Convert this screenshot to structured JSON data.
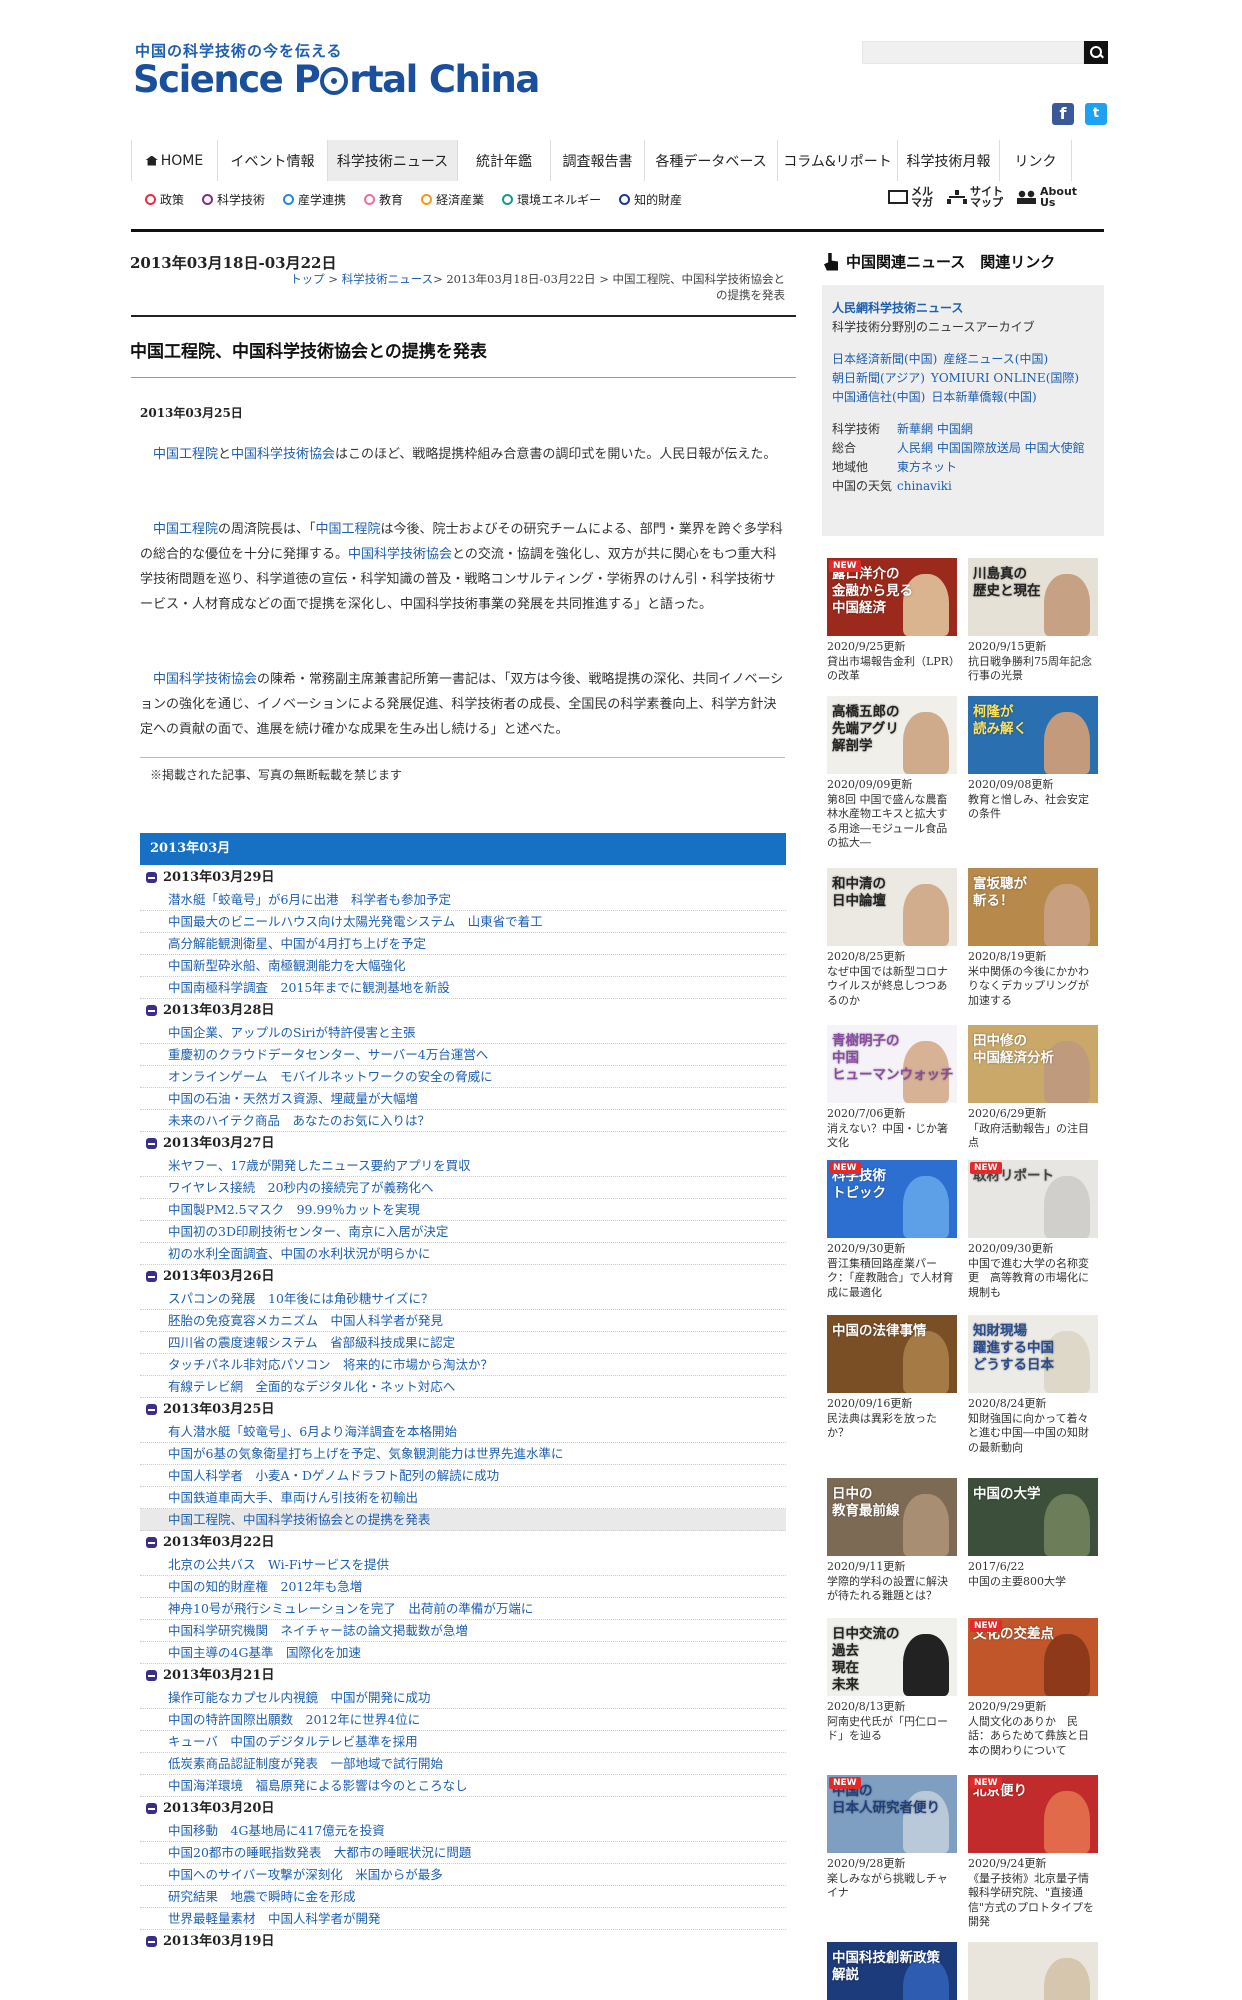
{
  "header": {
    "tagline": "中国の科学技術の今を伝える",
    "logo_part1": "Science P",
    "logo_part2": "rtal",
    "logo_part3": "China"
  },
  "global_nav": [
    {
      "label": "HOME",
      "width": 87
    },
    {
      "label": "イベント情報",
      "width": 110
    },
    {
      "label": "科学技術ニュース",
      "width": 130,
      "active": true
    },
    {
      "label": "統計年鑑",
      "width": 93
    },
    {
      "label": "調査報告書",
      "width": 94
    },
    {
      "label": "各種データベース",
      "width": 133
    },
    {
      "label": "コラム&リポート",
      "width": 120
    },
    {
      "label": "科学技術月報",
      "width": 102
    },
    {
      "label": "リンク",
      "width": 72
    }
  ],
  "sub_nav": [
    {
      "label": "政策",
      "color": "#e0304a"
    },
    {
      "label": "科学技術",
      "color": "#7c2f8d"
    },
    {
      "label": "産学連携",
      "color": "#2e86d1"
    },
    {
      "label": "教育",
      "color": "#ef6da0"
    },
    {
      "label": "経済産業",
      "color": "#f39a1e"
    },
    {
      "label": "環境エネルギー",
      "color": "#139d8a"
    },
    {
      "label": "知的財産",
      "color": "#1b3a8f"
    }
  ],
  "util_nav": [
    {
      "line1": "メル",
      "line2": "マガ"
    },
    {
      "line1": "サイト",
      "line2": "マップ"
    },
    {
      "line1": "About",
      "line2": "Us"
    }
  ],
  "main": {
    "date_range": "2013年03月18日-03月22日",
    "breadcrumb_top": "トップ",
    "breadcrumb_news": "科学技術ニュース",
    "breadcrumb_rest": "> 2013年03月18日-03月22日 > 中国工程院、中国科学技術協会との提携を発表",
    "title": "中国工程院、中国科学技術協会との提携を発表",
    "article_date": "2013年03月25日",
    "para1": {
      "l1": "中国工程院",
      "t1": "と",
      "l2": "中国科学技術協会",
      "t2": "はこのほど、戦略提携枠組み合意書の調印式を開いた。人民日報が伝えた。"
    },
    "para2": {
      "l1": "中国工程院",
      "t1": "の周済院長は、「",
      "l2": "中国工程院",
      "t2": "は今後、院士およびその研究チームによる、部門・業界を跨ぐ多学科の総合的な優位を十分に発揮する。",
      "l3": "中国科学技術協会",
      "t3": "との交流・協調を強化し、双方が共に関心をもつ重大科学技術問題を巡り、科学道徳の宣伝・科学知識の普及・戦略コンサルティング・学術界のけん引・科学技術サービス・人材育成などの面で提携を深化し、中国科学技術事業の発展を共同推進する」と語った。"
    },
    "para3": {
      "l1": "中国科学技術協会",
      "t1": "の陳希・常務副主席兼書記所第一書記は、「双方は今後、戦略提携の深化、共同イノベーションの強化を通じ、イノベーションによる発展促進、科学技術者の成長、全国民の科学素養向上、科学方針決定への貢献の面で、進展を続け確かな成果を生み出し続ける」と述べた。"
    },
    "copyright": "※掲載された記事、写真の無断転載を禁じます"
  },
  "archive": {
    "month": "2013年03月",
    "days": [
      {
        "date": "2013年03月29日",
        "items": [
          "潜水艇「蛟竜号」が6月に出港　科学者も参加予定",
          "中国最大のビニールハウス向け太陽光発電システム　山東省で着工",
          "高分解能観測衛星、中国が4月打ち上げを予定",
          "中国新型砕氷船、南極観測能力を大幅強化",
          "中国南極科学調査　2015年までに観測基地を新設"
        ]
      },
      {
        "date": "2013年03月28日",
        "items": [
          "中国企業、アップルのSiriが特許侵害と主張",
          "重慶初のクラウドデータセンター、サーバー4万台運営へ",
          "オンラインゲーム　モバイルネットワークの安全の脅威に",
          "中国の石油・天然ガス資源、埋蔵量が大幅増",
          "未来のハイテク商品　あなたのお気に入りは？"
        ]
      },
      {
        "date": "2013年03月27日",
        "items": [
          "米ヤフー、17歳が開発したニュース要約アプリを買収",
          "ワイヤレス接続　20秒内の接続完了が義務化へ",
          "中国製PM2.5マスク　99.99％カットを実現",
          "中国初の3D印刷技術センター、南京に入居が決定",
          "初の水利全面調査、中国の水利状況が明らかに"
        ]
      },
      {
        "date": "2013年03月26日",
        "items": [
          "スパコンの発展　10年後には角砂糖サイズに？",
          "胚胎の免疫寛容メカニズム　中国人科学者が発見",
          "四川省の震度速報システム　省部級科技成果に認定",
          "タッチパネル非対応パソコン　将来的に市場から淘汰か？",
          "有線テレビ網　全面的なデジタル化・ネット対応へ"
        ]
      },
      {
        "date": "2013年03月25日",
        "items": [
          "有人潜水艇「蛟竜号」、6月より海洋調査を本格開始",
          "中国が6基の気象衛星打ち上げを予定、気象観測能力は世界先進水準に",
          "中国人科学者　小麦A・Dゲノムドラフト配列の解読に成功",
          "中国鉄道車両大手、車両けん引技術を初輸出",
          "中国工程院、中国科学技術協会との提携を発表"
        ],
        "current": 4
      },
      {
        "date": "2013年03月22日",
        "items": [
          "北京の公共バス　Wi-Fiサービスを提供",
          "中国の知的財産権　2012年も急増",
          "神舟10号が飛行シミュレーションを完了　出荷前の準備が万端に",
          "中国科学研究機関　ネイチャー誌の論文掲載数が急増",
          "中国主導の4G基準　国際化を加速"
        ]
      },
      {
        "date": "2013年03月21日",
        "items": [
          "操作可能なカプセル内視鏡　中国が開発に成功",
          "中国の特許国際出願数　2012年に世界4位に",
          "キューバ　中国のデジタルテレビ基準を採用",
          "低炭素商品認証制度が発表　一部地域で試行開始",
          "中国海洋環境　福島原発による影響は今のところなし"
        ]
      },
      {
        "date": "2013年03月20日",
        "items": [
          "中国移動　4G基地局に417億元を投資",
          "中国20都市の睡眠指数発表　大都市の睡眠状況に問題",
          "中国へのサイバー攻撃が深刻化　米国からが最多",
          "研究結果　地震で瞬時に金を形成",
          "世界最軽量素材　中国人科学者が開発"
        ]
      },
      {
        "date": "2013年03月19日",
        "items": []
      }
    ]
  },
  "sidebar": {
    "title": "中国関連ニュース　関連リンク",
    "people_link": "人民網科学技術ニュース",
    "people_desc": "科学技術分野別のニュースアーカイブ",
    "news_rows": [
      [
        "日本経済新聞(中国)",
        "産経ニュース(中国)"
      ],
      [
        "朝日新聞(アジア)",
        "YOMIURI ONLINE(国際)"
      ],
      [
        "中国通信社(中国)",
        "日本新華僑報(中国)"
      ]
    ],
    "link_rows": [
      {
        "label": "科学技術",
        "links": [
          "新華網 中国網"
        ]
      },
      {
        "label": "総合",
        "links": [
          "人民網 中国国際放送局 中国大使館"
        ]
      },
      {
        "label": "地域他",
        "links": [
          "東方ネット"
        ]
      },
      {
        "label": "中国の天気",
        "links": [
          "chinaviki"
        ]
      }
    ]
  },
  "cards": [
    {
      "title": "露口洋介の\n金融から見る\n中国経済",
      "date": "2020/9/25更新",
      "desc": "貸出市場報告金利（LPR）の改革",
      "new": true,
      "bg": "#9c2a1c",
      "tc": "#fff",
      "face": "#d9b48f"
    },
    {
      "title": "川島真の\n歴史と現在",
      "date": "2020/9/15更新",
      "desc": "抗日戦争勝利75周年記念行事の光景",
      "new": false,
      "bg": "#e6e1d6",
      "tc": "#222",
      "face": "#c7a183"
    },
    {
      "title": "高橋五郎の\n先端アグリ\n解剖学",
      "date": "2020/09/09更新",
      "desc": "第8回 中国で盛んな農畜林水産物エキスと拡大する用途―モジュール食品の拡大―",
      "new": false,
      "bg": "#f1efe9",
      "tc": "#222",
      "face": "#cfab8c"
    },
    {
      "title": "柯隆が\n読み解く",
      "date": "2020/09/08更新",
      "desc": "教育と憎しみ、社会安定の条件",
      "new": false,
      "bg": "#2a6fb0",
      "tc": "#ffe25c",
      "face": "#c49a7c"
    },
    {
      "title": "和中清の\n日中論壇",
      "date": "2020/8/25更新",
      "desc": "なぜ中国では新型コロナウイルスが終息しつつあるのか",
      "new": false,
      "bg": "#ece9e2",
      "tc": "#222",
      "face": "#d2ad8d"
    },
    {
      "title": "富坂聰が\n斬る！",
      "date": "2020/8/19更新",
      "desc": "米中関係の今後にかかわりなくデカップリングが加速する",
      "new": false,
      "bg": "#b7894a",
      "tc": "#fff",
      "face": "#c8a07f"
    },
    {
      "title": "青樹明子の\n中国\nヒューマンウォッチ",
      "date": "2020/7/06更新",
      "desc": "消えない？中国・じか箸文化",
      "new": false,
      "bg": "#f5f3f7",
      "tc": "#8a4aa3",
      "face": "#d8b295"
    },
    {
      "title": "田中修の\n中国経済分析",
      "date": "2020/6/29更新",
      "desc": "「政府活動報告」の注目点",
      "new": false,
      "bg": "#caa86a",
      "tc": "#fff",
      "face": "#c09a7c"
    },
    {
      "title": "科学技術\nトピック",
      "date": "2020/9/30更新",
      "desc": "晋江集積回路産業パーク：「産教融合」で人材育成に最適化",
      "new": true,
      "bg": "#2d6fd0",
      "tc": "#fff",
      "face": "#5ea0e8"
    },
    {
      "title": "取材リポート",
      "date": "2020/09/30更新",
      "desc": "中国で進む大学の名称変更　高等教育の市場化に規制も",
      "new": true,
      "bg": "#e8e6e3",
      "tc": "#444",
      "face": "#d1cfcc"
    },
    {
      "title": "中国の法律事情",
      "date": "2020/09/16更新",
      "desc": "民法典は異彩を放ったか？",
      "new": false,
      "bg": "#7a4f25",
      "tc": "#fff",
      "face": "#a57a45"
    },
    {
      "title": "知財現場\n躍進する中国\nどうする日本",
      "date": "2020/8/24更新",
      "desc": "知財強国に向かって着々と進む中国―中国の知財の最新動向",
      "new": false,
      "bg": "#ecebe6",
      "tc": "#2a4c8f",
      "face": "#ddd8c8"
    },
    {
      "title": "日中の\n教育最前線",
      "date": "2020/9/11更新",
      "desc": "学際的学科の設置に解決が待たれる難題とは？",
      "new": false,
      "bg": "#7d6a55",
      "tc": "#fff",
      "face": "#a88e73"
    },
    {
      "title": "中国の大学",
      "date": "2017/6/22",
      "desc": "中国の主要800大学",
      "new": false,
      "bg": "#3c4f3a",
      "tc": "#fff",
      "face": "#6c7d5a"
    },
    {
      "title": "日中交流の\n過去\n現在\n未来",
      "date": "2020/8/13更新",
      "desc": "阿南史代氏が「円仁ロード」を辿る",
      "new": false,
      "bg": "#f0f0ec",
      "tc": "#222",
      "face": "#222"
    },
    {
      "title": "文化の交差点",
      "date": "2020/9/29更新",
      "desc": "人間文化のありか　民話：あらためて彝族と日本の関わりについて",
      "new": true,
      "bg": "#c1562a",
      "tc": "#fff",
      "face": "#8e3a1a"
    },
    {
      "title": "中国の\n日本人研究者便り",
      "date": "2020/9/28更新",
      "desc": "楽しみながら挑戦しチャイナ",
      "new": true,
      "bg": "#7f9fc2",
      "tc": "#1f3f7a",
      "face": "#b9c9da"
    },
    {
      "title": "北京便り",
      "date": "2020/9/24更新",
      "desc": "《量子技術》北京量子情報科学研究院、\"直接通信\"方式のプロトタイプを開発",
      "new": true,
      "bg": "#c22b2b",
      "tc": "#fff",
      "face": "#e06a4a"
    },
    {
      "title": "中国科技創新政策\n解説",
      "date": "",
      "desc": "",
      "new": false,
      "bg": "#1c3b7a",
      "tc": "#fff",
      "face": "#2e5cb0"
    },
    {
      "title": "",
      "date": "",
      "desc": "",
      "new": false,
      "bg": "#e9e5dc",
      "tc": "#222",
      "face": "#d5c6ad"
    }
  ]
}
